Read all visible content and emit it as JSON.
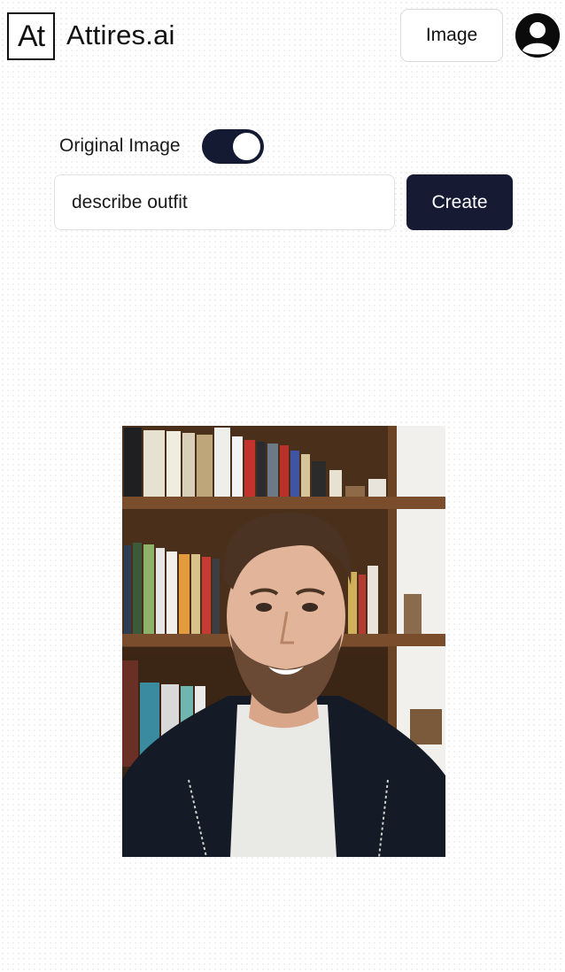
{
  "header": {
    "logo_text": "At",
    "brand_name": "Attires.ai",
    "image_button_label": "Image",
    "avatar_icon": "user-avatar-icon"
  },
  "controls": {
    "toggle_label": "Original Image",
    "toggle_on": true,
    "prompt_value": "describe outfit",
    "create_button_label": "Create"
  },
  "photo": {
    "description_icon": "portrait-photo"
  },
  "colors": {
    "accent": "#161a33",
    "border": "#e1e1e6",
    "background": "#ffffff"
  }
}
